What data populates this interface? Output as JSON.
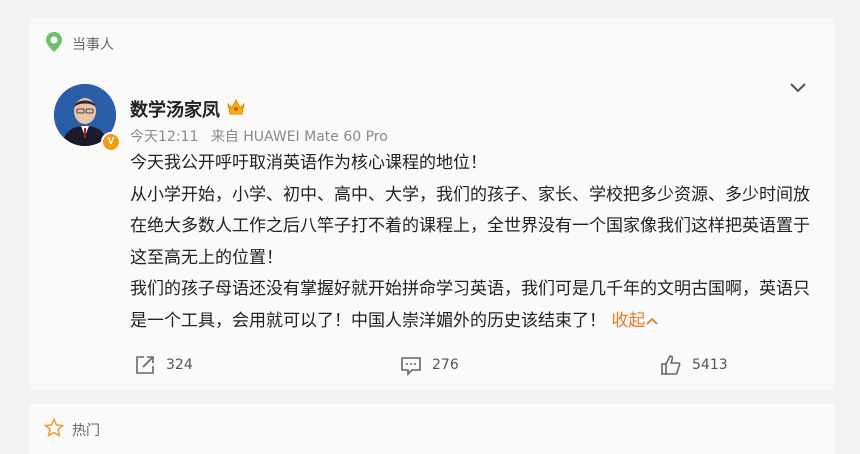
{
  "section_label": "当事人",
  "user": {
    "name": "数学汤家凤",
    "verified_badge": "V"
  },
  "meta": {
    "time": "今天12:11",
    "source": "来自 HUAWEI Mate 60 Pro"
  },
  "post": {
    "paragraphs": [
      "今天我公开呼吁取消英语作为核心课程的地位！",
      "从小学开始，小学、初中、高中、大学，我们的孩子、家长、学校把多少资源、多少时间放在绝大多数人工作之后八竿子打不着的课程上，全世界没有一个国家像我们这样把英语置于这至高无上的位置！",
      "我们的孩子母语还没有掌握好就开始拼命学习英语，我们可是几千年的文明古国啊，英语只是一个工具，会用就可以了！中国人崇洋媚外的历史该结束了！"
    ],
    "collapse_label": "收起"
  },
  "actions": {
    "share_count": "324",
    "comment_count": "276",
    "like_count": "5413"
  },
  "hot_label": "热门",
  "colors": {
    "accent": "#e87a2b",
    "badge": "#f39c12",
    "location_icon": "#6cc06a"
  }
}
